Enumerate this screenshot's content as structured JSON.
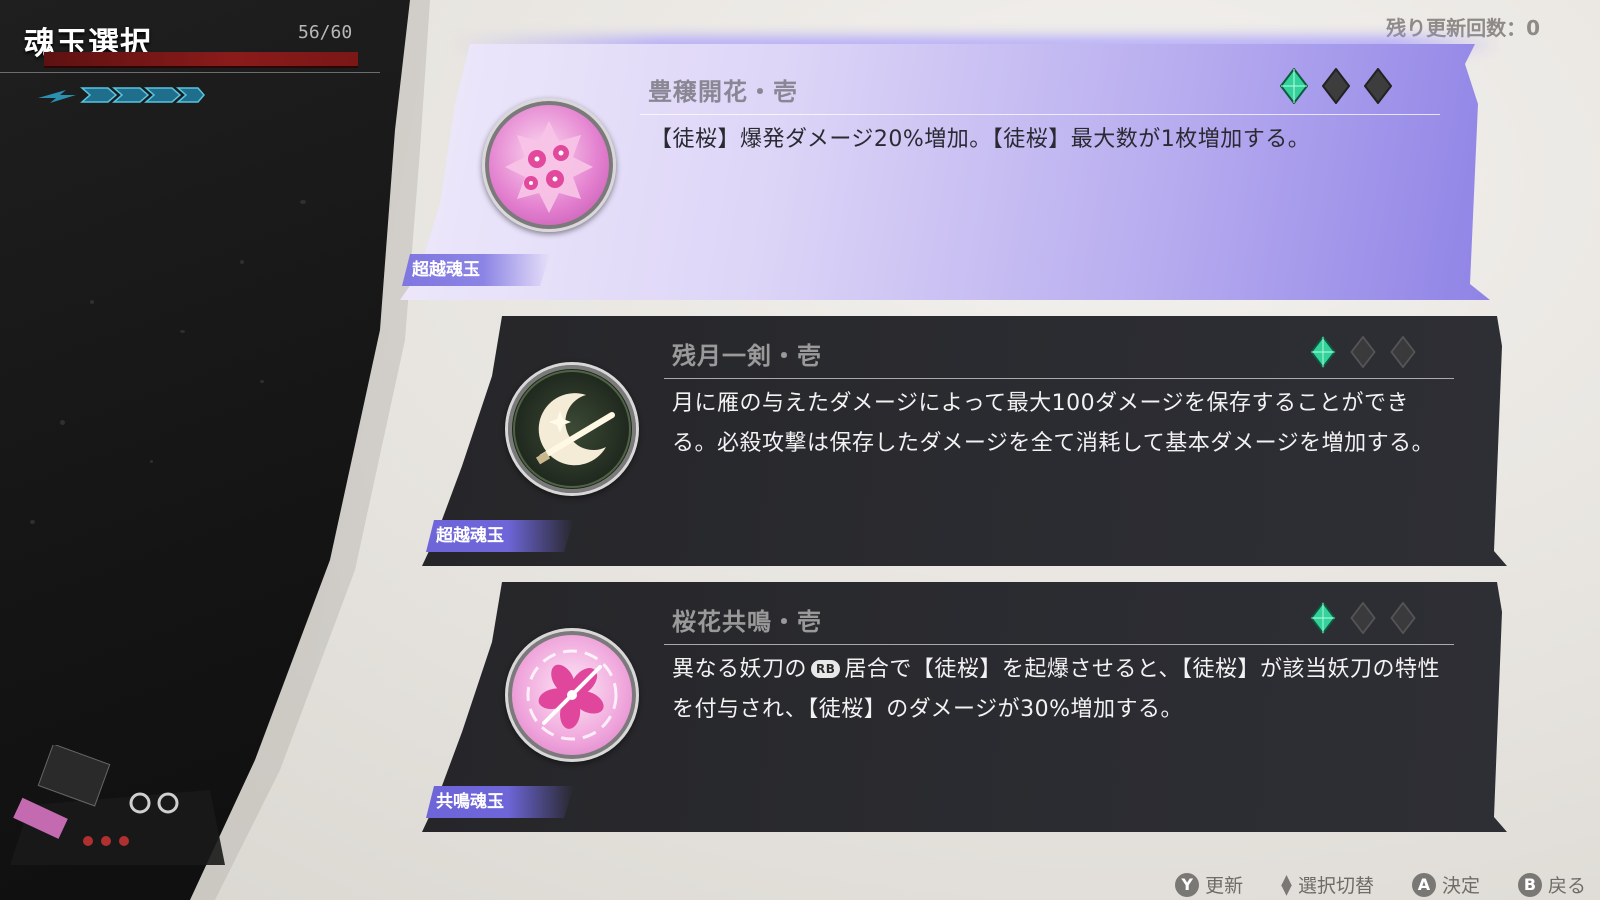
{
  "screen": {
    "title": "魂玉選択",
    "hp_text": "56/60",
    "hp": {
      "current": 56,
      "max": 60
    },
    "refresh_label": "残り更新回数：0"
  },
  "cards": [
    {
      "title": "豊穣開花・壱",
      "description": "【徒桜】爆発ダメージ20%増加。【徒桜】最大数が1枚増加する。",
      "tier": "超越魂玉",
      "rank_filled": 1,
      "rank_total": 3,
      "icon": "cherry-blossom-burst-icon",
      "selected": true
    },
    {
      "title": "残月一剣・壱",
      "description": "月に雁の与えたダメージによって最大100ダメージを保存することができる。必殺攻撃は保存したダメージを全て消耗して基本ダメージを増加する。",
      "tier": "超越魂玉",
      "rank_filled": 1,
      "rank_total": 3,
      "icon": "crescent-moon-sword-icon",
      "selected": false
    },
    {
      "title": "桜花共鳴・壱",
      "description_before": "異なる妖刀の",
      "button_badge": "RB",
      "description_after": "居合で【徒桜】を起爆させると、【徒桜】が該当妖刀の特性を付与され、【徒桜】のダメージが30%増加する。",
      "tier": "共鳴魂玉",
      "rank_filled": 1,
      "rank_total": 3,
      "icon": "sakura-flower-icon",
      "selected": false
    }
  ],
  "controls": [
    {
      "button": "Y",
      "label": "更新"
    },
    {
      "button": "updown",
      "label": "選択切替"
    },
    {
      "button": "A",
      "label": "決定"
    },
    {
      "button": "B",
      "label": "戻る"
    }
  ],
  "colors": {
    "gem_filled": "#34d29a",
    "gem_empty": "#3d3d3d",
    "tier_band": "#6e66d8",
    "hp_bar": "#8a1b1b",
    "selected_card": "#a89df0"
  }
}
